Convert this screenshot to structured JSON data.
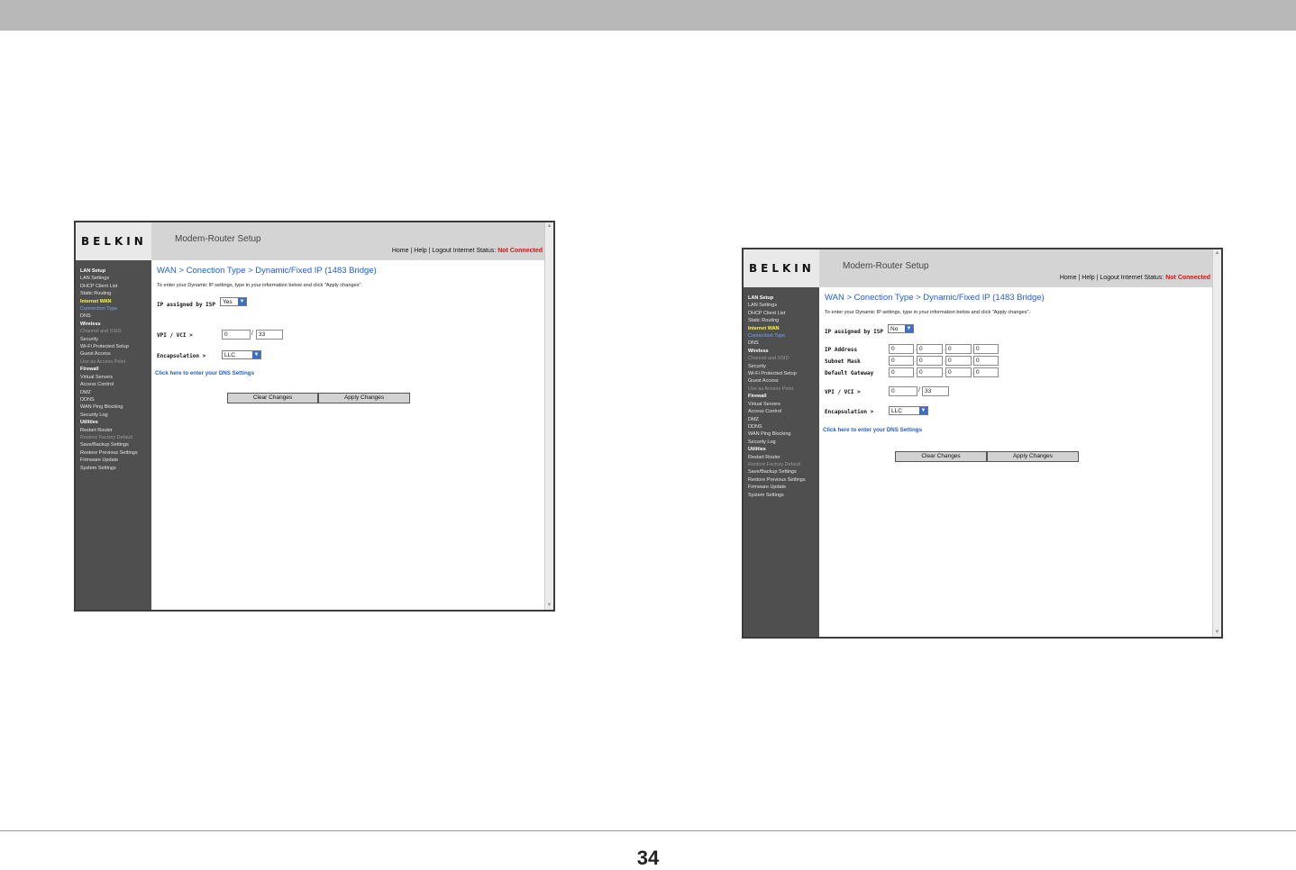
{
  "page": {
    "number": "34"
  },
  "router": {
    "logo": "BELKIN",
    "title": "Modem-Router Setup",
    "nav_links": {
      "home": "Home",
      "help": "Help",
      "logout": "Logout",
      "sep": "|"
    },
    "internet_status_label": "Internet Status:",
    "internet_status_value": "Not Connected",
    "status_color": "#e01010",
    "accent_color": "#1f5fd6",
    "sidebar": [
      {
        "label": "LAN Setup",
        "type": "head"
      },
      {
        "label": "LAN Settings",
        "type": "item"
      },
      {
        "label": "DHCP Client List",
        "type": "item"
      },
      {
        "label": "Static Routing",
        "type": "item"
      },
      {
        "label": "Internet WAN",
        "type": "active"
      },
      {
        "label": "Connection Type",
        "type": "current"
      },
      {
        "label": "DNS",
        "type": "item"
      },
      {
        "label": "Wireless",
        "type": "head"
      },
      {
        "label": "Channel and SSID",
        "type": "dim"
      },
      {
        "label": "Security",
        "type": "item"
      },
      {
        "label": "Wi-Fi Protected Setup",
        "type": "item"
      },
      {
        "label": "Guest Access",
        "type": "item"
      },
      {
        "label": "Use as Access Point",
        "type": "dim"
      },
      {
        "label": "Firewall",
        "type": "head"
      },
      {
        "label": "Virtual Servers",
        "type": "item"
      },
      {
        "label": "Access Control",
        "type": "item"
      },
      {
        "label": "DMZ",
        "type": "item"
      },
      {
        "label": "DDNS",
        "type": "item"
      },
      {
        "label": "WAN Ping Blocking",
        "type": "item"
      },
      {
        "label": "Security Log",
        "type": "item"
      },
      {
        "label": "Utilities",
        "type": "head"
      },
      {
        "label": "Restart Router",
        "type": "item"
      },
      {
        "label": "Restore Factory Default",
        "type": "dim"
      },
      {
        "label": "Save/Backup Settings",
        "type": "item"
      },
      {
        "label": "Restore Previous Settings",
        "type": "item"
      },
      {
        "label": "Firmware Update",
        "type": "item"
      },
      {
        "label": "System Settings",
        "type": "item"
      }
    ],
    "page_title": "WAN > Conection Type > Dynamic/Fixed IP (1483 Bridge)",
    "description": "To enter your Dynamic IP settings, type in your information below and click \"Apply changes\".",
    "ip_assigned_label": "IP assigned by ISP",
    "vpi_vci_label": "VPI / VCI >",
    "encapsulation_label": "Encapsulation >",
    "dns_link": "Click here to enter your DNS Settings",
    "clear_button": "Clear Changes",
    "apply_button": "Apply Changes",
    "slash": "/",
    "ip_dot": "."
  },
  "screenshot_left": {
    "ip_assigned_value": "Yes",
    "vpi": "0",
    "vci": "33",
    "encapsulation": "LLC"
  },
  "screenshot_right": {
    "ip_assigned_value": "No",
    "ip_address_label": "IP Address",
    "subnet_mask_label": "Subnet Mask",
    "default_gateway_label": "Default Gateway",
    "ip_address": [
      "0",
      "0",
      "0",
      "0"
    ],
    "subnet_mask": [
      "0",
      "0",
      "0",
      "0"
    ],
    "default_gateway": [
      "0",
      "0",
      "0",
      "0"
    ],
    "vpi": "0",
    "vci": "33",
    "encapsulation": "LLC"
  }
}
